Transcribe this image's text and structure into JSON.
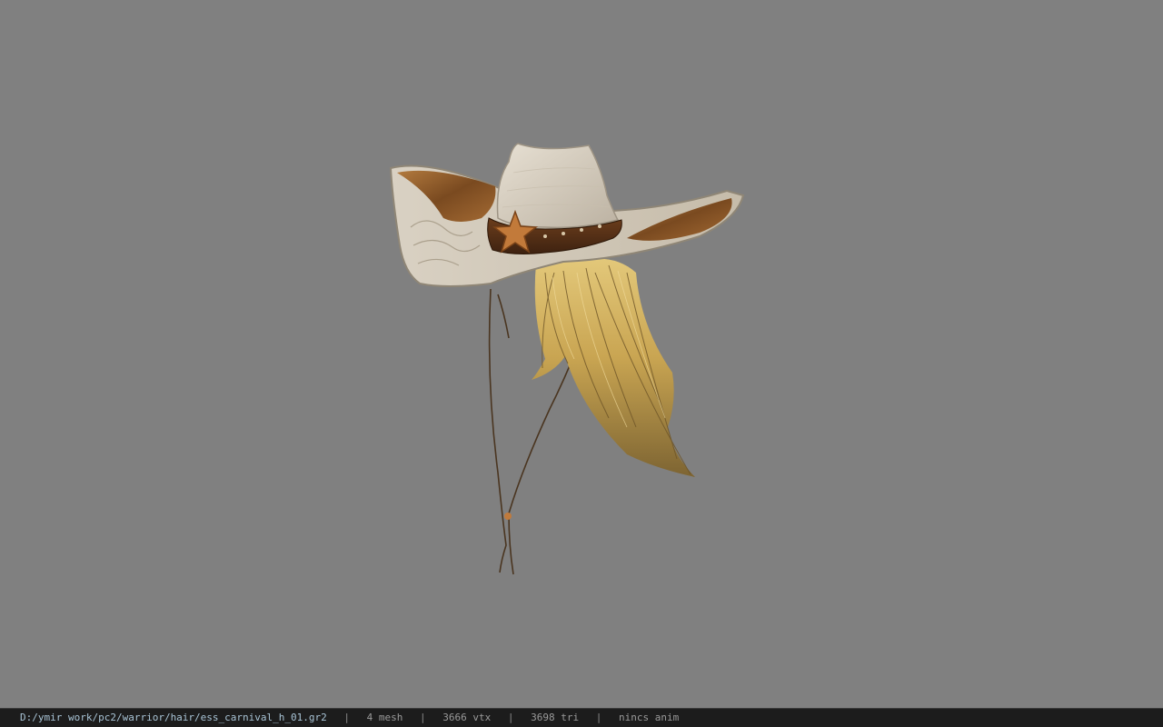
{
  "viewport": {
    "background_color": "#808080",
    "model_name": "cowboy-hat-with-blonde-hair"
  },
  "status_bar": {
    "file_path": "D:/ymir work/pc2/warrior/hair/ess_carnival_h_01.gr2",
    "separator": "|",
    "mesh_count": "4 mesh",
    "vertex_count": "3666 vtx",
    "triangle_count": "3698 tri",
    "animation": "nincs anim"
  }
}
